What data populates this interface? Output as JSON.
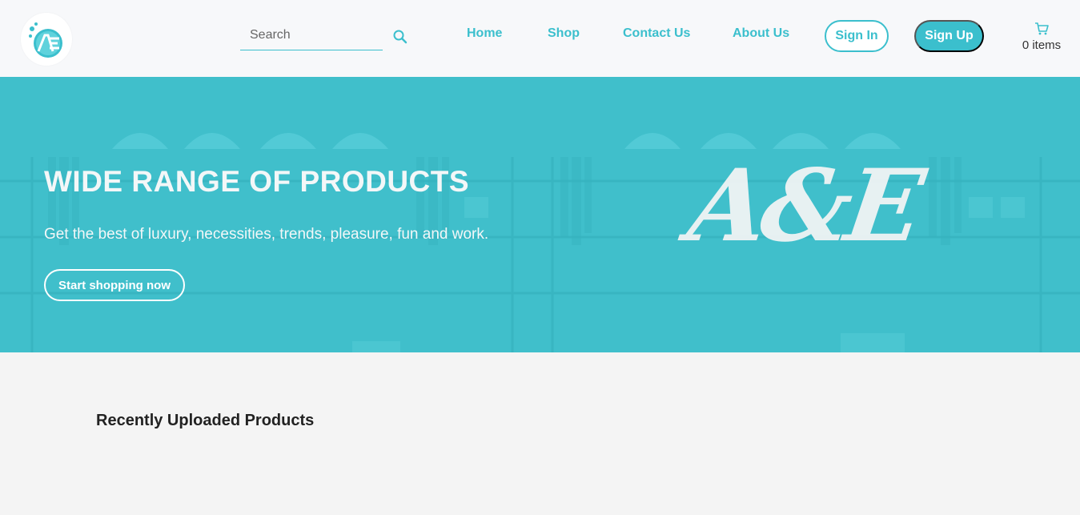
{
  "brand": {
    "logo_icon": "ae-logo-icon",
    "accent_color": "#3bbfcd"
  },
  "search": {
    "placeholder": "Search",
    "value": "",
    "icon": "search-icon"
  },
  "nav": {
    "links": [
      {
        "label": "Home"
      },
      {
        "label": "Shop"
      },
      {
        "label": "Contact Us"
      },
      {
        "label": "About Us"
      }
    ],
    "sign_in_label": "Sign In",
    "sign_up_label": "Sign Up"
  },
  "cart": {
    "icon": "cart-icon",
    "count_label": "0 items"
  },
  "hero": {
    "title": "WIDE RANGE OF PRODUCTS",
    "subtitle": "Get the best of luxury, necessities, trends, pleasure, fun and work.",
    "cta_label": "Start shopping now",
    "logo_text": "A&E",
    "overlay_color": "#3ebfca"
  },
  "main": {
    "section_title": "Recently Uploaded Products"
  }
}
